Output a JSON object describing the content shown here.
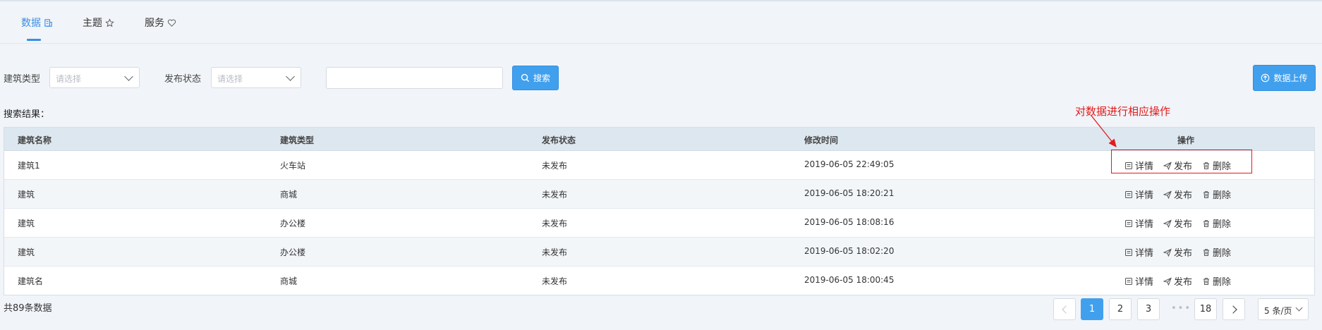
{
  "tabs": [
    {
      "label": "数据",
      "icon": "database-icon"
    },
    {
      "label": "主题",
      "icon": "star-outline-icon"
    },
    {
      "label": "服务",
      "icon": "heart-outline-icon"
    }
  ],
  "filters": {
    "building_type_label": "建筑类型",
    "building_type_placeholder": "请选择",
    "publish_status_label": "发布状态",
    "publish_status_placeholder": "请选择",
    "search_button": "搜索",
    "upload_button": "数据上传"
  },
  "results_label": "搜索结果：",
  "annotation": "对数据进行相应操作",
  "table": {
    "headers": [
      "建筑名称",
      "建筑类型",
      "发布状态",
      "修改时间",
      "操作"
    ],
    "rows": [
      {
        "name": "建筑1",
        "type": "火车站",
        "status": "未发布",
        "time": "2019-06-05 22:49:05"
      },
      {
        "name": "建筑",
        "type": "商城",
        "status": "未发布",
        "time": "2019-06-05 18:20:21"
      },
      {
        "name": "建筑",
        "type": "办公楼",
        "status": "未发布",
        "time": "2019-06-05 18:08:16"
      },
      {
        "name": "建筑",
        "type": "办公楼",
        "status": "未发布",
        "time": "2019-06-05 18:02:20"
      },
      {
        "name": "建筑名",
        "type": "商城",
        "status": "未发布",
        "time": "2019-06-05 18:00:45"
      }
    ],
    "actions": {
      "detail": "详情",
      "publish": "发布",
      "delete": "删除"
    }
  },
  "pagination": {
    "total": "共89条数据",
    "pages": [
      "1",
      "2",
      "3",
      "18"
    ],
    "current": "1",
    "ellipsis": "•••",
    "page_size": "5 条/页"
  },
  "colors": {
    "accent": "#41a0ee",
    "annotation": "#e21b1b"
  }
}
